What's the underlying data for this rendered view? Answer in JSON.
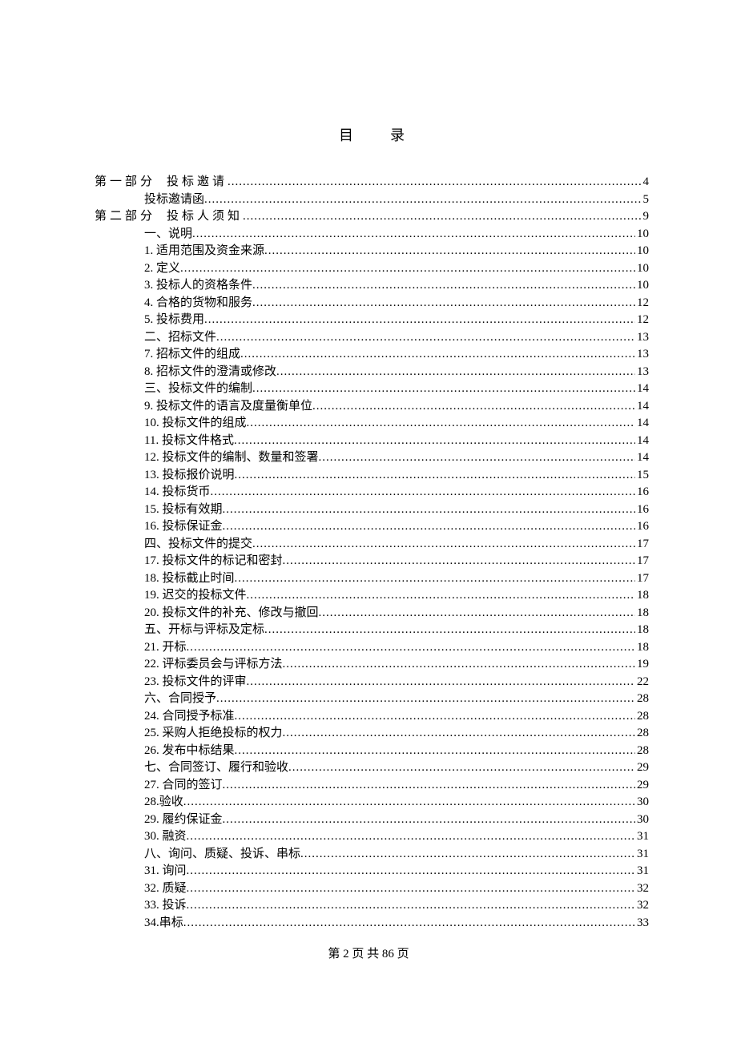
{
  "title": "目录",
  "footer": "第 2 页 共 86 页",
  "toc": [
    {
      "level": 0,
      "prefix": "第一部分",
      "label": "投标邀请",
      "page": "4"
    },
    {
      "level": 1,
      "prefix": "",
      "label": "投标邀请函",
      "page": "5"
    },
    {
      "level": 0,
      "prefix": "第二部分",
      "label": "投标人须知",
      "page": "9"
    },
    {
      "level": 2,
      "prefix": "一、",
      "label": "说明",
      "page": "10"
    },
    {
      "level": 2,
      "prefix": "1. ",
      "label": "适用范围及资金来源",
      "page": "10"
    },
    {
      "level": 2,
      "prefix": "2. ",
      "label": "定义",
      "page": "10"
    },
    {
      "level": 2,
      "prefix": "3. ",
      "label": "投标人的资格条件",
      "page": "10"
    },
    {
      "level": 2,
      "prefix": "4. ",
      "label": "合格的货物和服务",
      "page": "12"
    },
    {
      "level": 2,
      "prefix": "5. ",
      "label": "投标费用",
      "page": "12"
    },
    {
      "level": 2,
      "prefix": "二、",
      "label": "招标文件",
      "page": "13"
    },
    {
      "level": 2,
      "prefix": "7. ",
      "label": "招标文件的组成",
      "page": "13"
    },
    {
      "level": 2,
      "prefix": "8. ",
      "label": "招标文件的澄清或修改",
      "page": "13"
    },
    {
      "level": 2,
      "prefix": "三、",
      "label": "投标文件的编制",
      "page": "14"
    },
    {
      "level": 2,
      "prefix": "9. ",
      "label": "投标文件的语言及度量衡单位",
      "page": "14"
    },
    {
      "level": 2,
      "prefix": "10. ",
      "label": "投标文件的组成",
      "page": "14"
    },
    {
      "level": 2,
      "prefix": "11. ",
      "label": "投标文件格式",
      "page": "14"
    },
    {
      "level": 2,
      "prefix": "12. ",
      "label": "投标文件的编制、数量和签署",
      "page": "14"
    },
    {
      "level": 2,
      "prefix": "13. ",
      "label": "投标报价说明",
      "page": "15"
    },
    {
      "level": 2,
      "prefix": "14. ",
      "label": "投标货币",
      "page": "16"
    },
    {
      "level": 2,
      "prefix": "15. ",
      "label": "投标有效期",
      "page": "16"
    },
    {
      "level": 2,
      "prefix": "16. ",
      "label": "投标保证金",
      "page": "16"
    },
    {
      "level": 2,
      "prefix": "四、",
      "label": "投标文件的提交",
      "page": "17"
    },
    {
      "level": 2,
      "prefix": "17. ",
      "label": "投标文件的标记和密封",
      "page": "17"
    },
    {
      "level": 2,
      "prefix": "18. ",
      "label": "投标截止时间",
      "page": "17"
    },
    {
      "level": 2,
      "prefix": "19. ",
      "label": "迟交的投标文件",
      "page": "18"
    },
    {
      "level": 2,
      "prefix": "20. ",
      "label": "投标文件的补充、修改与撤回",
      "page": "18"
    },
    {
      "level": 2,
      "prefix": "五、",
      "label": "开标与评标及定标",
      "page": "18"
    },
    {
      "level": 2,
      "prefix": "21. ",
      "label": "开标",
      "page": "18"
    },
    {
      "level": 2,
      "prefix": "22. ",
      "label": "评标委员会与评标方法",
      "page": "19"
    },
    {
      "level": 2,
      "prefix": "23. ",
      "label": "投标文件的评审",
      "page": "22"
    },
    {
      "level": 2,
      "prefix": "六、",
      "label": "合同授予",
      "page": "28"
    },
    {
      "level": 2,
      "prefix": "24. ",
      "label": "合同授予标准",
      "page": "28"
    },
    {
      "level": 2,
      "prefix": "25. ",
      "label": "采购人拒绝投标的权力",
      "page": "28"
    },
    {
      "level": 2,
      "prefix": "26. ",
      "label": "发布中标结果",
      "page": "28"
    },
    {
      "level": 2,
      "prefix": "七、",
      "label": "合同签订、履行和验收",
      "page": "29"
    },
    {
      "level": 2,
      "prefix": "27. ",
      "label": "合同的签订",
      "page": "29"
    },
    {
      "level": 2,
      "prefix": "28.",
      "label": "验收",
      "page": "30"
    },
    {
      "level": 2,
      "prefix": "29. ",
      "label": "履约保证金",
      "page": "30"
    },
    {
      "level": 2,
      "prefix": "30. ",
      "label": "融资",
      "page": "31"
    },
    {
      "level": 2,
      "prefix": "八、",
      "label": "询问、质疑、投诉、串标",
      "page": "31"
    },
    {
      "level": 2,
      "prefix": "31. ",
      "label": "询问",
      "page": "31"
    },
    {
      "level": 2,
      "prefix": "32. ",
      "label": "质疑",
      "page": "32"
    },
    {
      "level": 2,
      "prefix": "33. ",
      "label": "投诉",
      "page": "32"
    },
    {
      "level": 2,
      "prefix": "34.",
      "label": "串标",
      "page": "33"
    }
  ]
}
